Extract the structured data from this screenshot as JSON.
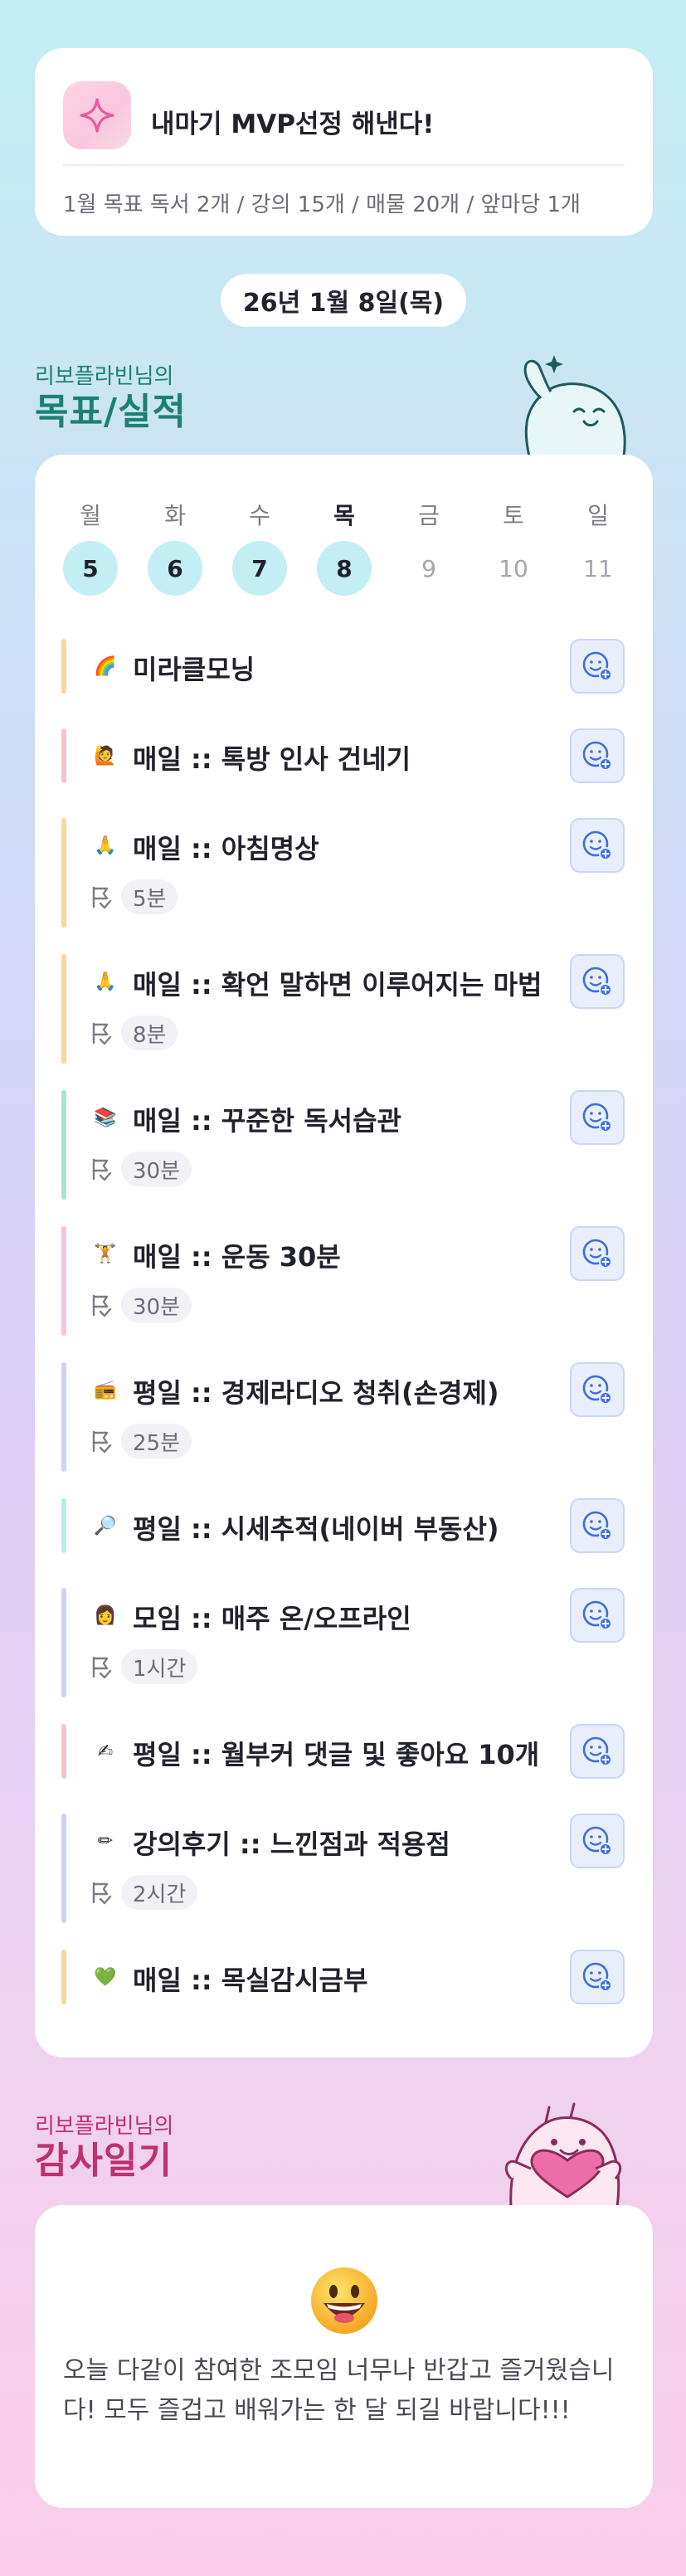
{
  "goal": {
    "icon": "sparkle-icon",
    "title": "내마기 MVP선정 해낸다!",
    "subtitle": "1월 목표  독서 2개 / 강의 15개 / 매물 20개 / 앞마당 1개"
  },
  "date": "26년 1월 8일(목)",
  "goals_section": {
    "owner": "리보플라빈님의",
    "title": "목표/실적"
  },
  "week": {
    "days": [
      "월",
      "화",
      "수",
      "목",
      "금",
      "토",
      "일"
    ],
    "dates": [
      "5",
      "6",
      "7",
      "8",
      "9",
      "10",
      "11"
    ],
    "completed": [
      true,
      true,
      true,
      true,
      false,
      false,
      false
    ],
    "today_index": 3
  },
  "tasks": [
    {
      "emoji": "🌈",
      "title": "미라클모닝",
      "duration": null,
      "bar_color": "#f8d79a"
    },
    {
      "emoji": "🙋",
      "title": "매일 :: 톡방 인사 건네기",
      "duration": null,
      "bar_color": "#f6c4c8"
    },
    {
      "emoji": "🙏",
      "title": "매일 :: 아침명상",
      "duration": "5분",
      "bar_color": "#f8d79a"
    },
    {
      "emoji": "🙏",
      "title": "매일 :: 확언 말하면 이루어지는 마법",
      "duration": "8분",
      "bar_color": "#f8d79a"
    },
    {
      "emoji": "📚",
      "title": "매일 :: 꾸준한 독서습관",
      "duration": "30분",
      "bar_color": "#a5e6c8"
    },
    {
      "emoji": "🏋",
      "title": "매일 :: 운동 30분",
      "duration": "30분",
      "bar_color": "#f4c3e4"
    },
    {
      "emoji": "📻",
      "title": "평일 :: 경제라디오 청취(손경제)",
      "duration": "25분",
      "bar_color": "#cfd2f0"
    },
    {
      "emoji": "🔎",
      "title": "평일 :: 시세추적(네이버 부동산)",
      "duration": null,
      "bar_color": "#b9ece8"
    },
    {
      "emoji": "👩",
      "title": "모임 :: 매주 온/오프라인",
      "duration": "1시간",
      "bar_color": "#cfd2f0"
    },
    {
      "emoji": "✍",
      "title": "평일 :: 월부커 댓글 및 좋아요 10개",
      "duration": null,
      "bar_color": "#f6c4c8"
    },
    {
      "emoji": "✏",
      "title": "강의후기 :: 느낀점과 적용점",
      "duration": "2시간",
      "bar_color": "#cfd2f0"
    },
    {
      "emoji": "💚",
      "title": "매일 :: 목실감시금부",
      "duration": null,
      "bar_color": "#f8d79a"
    }
  ],
  "gratitude_section": {
    "owner": "리보플라빈님의",
    "title": "감사일기"
  },
  "gratitude": {
    "mood_icon": "grinning-face-icon",
    "text": "오늘 다같이 참여한 조모임 너무나 반갑고 즐거웠습니다! 모두 즐겁고 배워가는 한 달 되길 바랍니다!!!"
  },
  "colors": {
    "accent_teal": "#1d7f78",
    "accent_pink": "#c0306e",
    "day_done": "#c3eef3",
    "button_bg": "#e8eefc",
    "button_icon": "#3c6ee0"
  }
}
